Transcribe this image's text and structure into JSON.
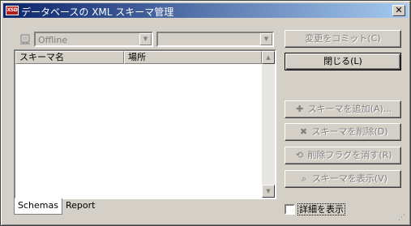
{
  "window": {
    "title": "データベースの XML スキーマ管理",
    "app_icon_text": "XSD",
    "close_glyph": "✕"
  },
  "connection": {
    "selected": "Offline",
    "second_selected": ""
  },
  "schemas_list": {
    "columns": [
      "スキーマ名",
      "場所"
    ],
    "rows": []
  },
  "tabs": [
    {
      "label": "Schemas",
      "active": true
    },
    {
      "label": "Report",
      "active": false
    }
  ],
  "buttons": {
    "commit": {
      "label": "変更をコミット(C)",
      "enabled": false
    },
    "close": {
      "label": "閉じる(L)",
      "enabled": true
    },
    "add_schema": {
      "label": "スキーマを追加(A)...",
      "enabled": false,
      "icon": "plus-icon"
    },
    "delete_schema": {
      "label": "スキーマを削除(D)",
      "enabled": false,
      "icon": "delete-icon"
    },
    "clear_delete_flag": {
      "label": "削除フラグを消す(R)",
      "enabled": false,
      "icon": "undo-flag-icon"
    },
    "show_schema": {
      "label": "スキーマを表示(V)",
      "enabled": false,
      "icon": "magnifier-icon"
    }
  },
  "details_checkbox": {
    "label": "詳細を表示",
    "checked": false
  }
}
